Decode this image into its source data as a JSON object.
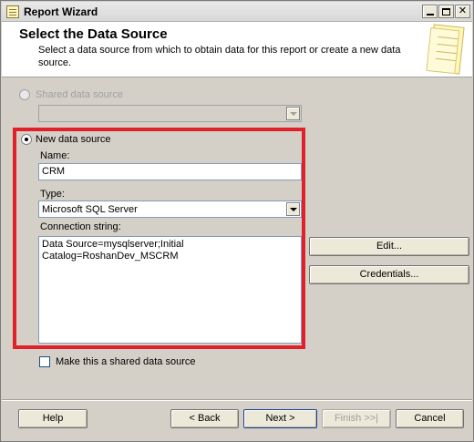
{
  "window": {
    "title": "Report Wizard"
  },
  "header": {
    "title": "Select the Data Source",
    "description": "Select a data source from which to obtain data for this report or create a new data source."
  },
  "shared_source": {
    "label": "Shared data source",
    "selected": false,
    "enabled": false,
    "value": ""
  },
  "new_source": {
    "label": "New data source",
    "selected": true,
    "name_label": "Name:",
    "name_value": "CRM",
    "type_label": "Type:",
    "type_value": "Microsoft SQL Server",
    "conn_label": "Connection string:",
    "conn_value": "Data Source=mysqlserver;Initial\nCatalog=RoshanDev_MSCRM"
  },
  "buttons": {
    "edit": "Edit...",
    "credentials": "Credentials...",
    "help": "Help",
    "back": "< Back",
    "next": "Next >",
    "finish": "Finish >>|",
    "cancel": "Cancel"
  },
  "shared_checkbox": {
    "label": "Make this a shared data source",
    "checked": false
  },
  "colors": {
    "highlight": "#e0202a",
    "dialog_bg": "#d4d0c8"
  }
}
